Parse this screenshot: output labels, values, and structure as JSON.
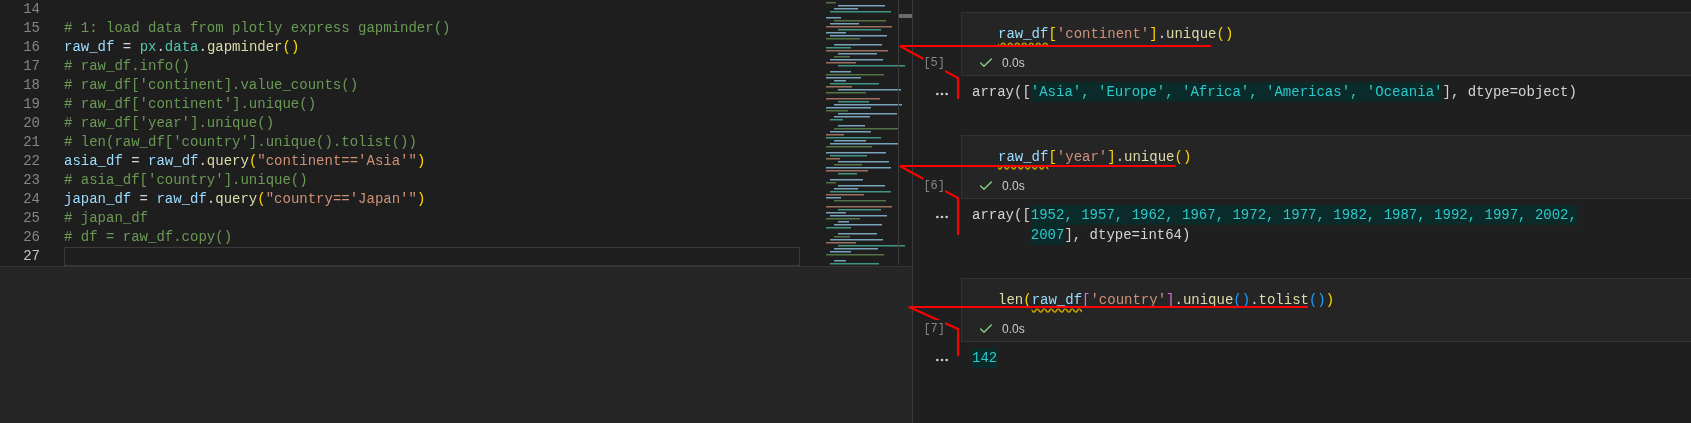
{
  "editor": {
    "lines": [
      {
        "number": "14",
        "current": false
      },
      {
        "number": "15",
        "current": false,
        "tokens": [
          {
            "text": "# 1: load data from plotly express gapminder()",
            "kind": "comment"
          }
        ]
      },
      {
        "number": "16",
        "current": false,
        "tokens": [
          {
            "text": "raw_df",
            "kind": "variable"
          },
          {
            "text": " = ",
            "kind": "plain"
          },
          {
            "text": "px",
            "kind": "module"
          },
          {
            "text": ".",
            "kind": "plain"
          },
          {
            "text": "data",
            "kind": "module"
          },
          {
            "text": ".",
            "kind": "plain"
          },
          {
            "text": "gapminder",
            "kind": "function"
          },
          {
            "text": "()",
            "kind": "bracket1"
          }
        ]
      },
      {
        "number": "17",
        "current": false,
        "tokens": [
          {
            "text": "# raw_df.info()",
            "kind": "comment"
          }
        ]
      },
      {
        "number": "18",
        "current": false,
        "tokens": [
          {
            "text": "# raw_df['continent].value_counts()",
            "kind": "comment"
          }
        ]
      },
      {
        "number": "19",
        "current": false,
        "tokens": [
          {
            "text": "# raw_df['continent'].unique()",
            "kind": "comment"
          }
        ]
      },
      {
        "number": "20",
        "current": false,
        "tokens": [
          {
            "text": "# raw_df['year'].unique()",
            "kind": "comment"
          }
        ]
      },
      {
        "number": "21",
        "current": false,
        "tokens": [
          {
            "text": "# len(raw_df['country'].unique().tolist())",
            "kind": "comment"
          }
        ]
      },
      {
        "number": "22",
        "current": false,
        "tokens": [
          {
            "text": "asia_df",
            "kind": "variable"
          },
          {
            "text": " = ",
            "kind": "plain"
          },
          {
            "text": "raw_df",
            "kind": "variable"
          },
          {
            "text": ".",
            "kind": "plain"
          },
          {
            "text": "query",
            "kind": "function"
          },
          {
            "text": "(",
            "kind": "bracket1"
          },
          {
            "text": "\"continent=='Asia'\"",
            "kind": "string"
          },
          {
            "text": ")",
            "kind": "bracket1"
          }
        ]
      },
      {
        "number": "23",
        "current": false,
        "tokens": [
          {
            "text": "# asia_df['country'].unique()",
            "kind": "comment"
          }
        ]
      },
      {
        "number": "24",
        "current": false,
        "tokens": [
          {
            "text": "japan_df",
            "kind": "variable"
          },
          {
            "text": " = ",
            "kind": "plain"
          },
          {
            "text": "raw_df",
            "kind": "variable"
          },
          {
            "text": ".",
            "kind": "plain"
          },
          {
            "text": "query",
            "kind": "function"
          },
          {
            "text": "(",
            "kind": "bracket1"
          },
          {
            "text": "\"country=='Japan'\"",
            "kind": "string"
          },
          {
            "text": ")",
            "kind": "bracket1"
          }
        ]
      },
      {
        "number": "25",
        "current": false,
        "tokens": [
          {
            "text": "# japan_df",
            "kind": "comment"
          }
        ]
      },
      {
        "number": "26",
        "current": false,
        "tokens": [
          {
            "text": "# df = raw_df.copy()",
            "kind": "comment"
          }
        ]
      },
      {
        "number": "27",
        "current": true
      }
    ]
  },
  "notebook": {
    "cells": [
      {
        "execution_count": "[5]",
        "duration": "0.0s",
        "code": [
          {
            "text": "raw_df",
            "kind": "variable",
            "warning": true
          },
          {
            "text": "[",
            "kind": "bracket1"
          },
          {
            "text": "'continent'",
            "kind": "string"
          },
          {
            "text": "]",
            "kind": "bracket1"
          },
          {
            "text": ".",
            "kind": "plain"
          },
          {
            "text": "unique",
            "kind": "function"
          },
          {
            "text": "()",
            "kind": "bracket1"
          }
        ],
        "output": [
          [
            {
              "text": "array([",
              "kind": "plain"
            },
            {
              "text": "'Asia', 'Europe', 'Africa', 'Americas', 'Oceania'",
              "kind": "value"
            },
            {
              "text": "], dtype=object)",
              "kind": "plain"
            }
          ]
        ]
      },
      {
        "execution_count": "[6]",
        "duration": "0.0s",
        "code": [
          {
            "text": "raw_df",
            "kind": "variable",
            "warning": true
          },
          {
            "text": "[",
            "kind": "bracket1"
          },
          {
            "text": "'year'",
            "kind": "string"
          },
          {
            "text": "]",
            "kind": "bracket1"
          },
          {
            "text": ".",
            "kind": "plain"
          },
          {
            "text": "unique",
            "kind": "function"
          },
          {
            "text": "()",
            "kind": "bracket1"
          }
        ],
        "output": [
          [
            {
              "text": "array([",
              "kind": "plain"
            },
            {
              "text": "1952, 1957, 1962, 1967, 1972, 1977, 1982, 1987, 1992, 1997, 2002,",
              "kind": "value"
            }
          ],
          [
            {
              "text": "2007",
              "kind": "value"
            },
            {
              "text": "], dtype=int64)",
              "kind": "plain"
            }
          ]
        ]
      },
      {
        "execution_count": "[7]",
        "duration": "0.0s",
        "code": [
          {
            "text": "len",
            "kind": "function"
          },
          {
            "text": "(",
            "kind": "bracket1"
          },
          {
            "text": "raw_df",
            "kind": "variable",
            "warning": true
          },
          {
            "text": "[",
            "kind": "bracket2"
          },
          {
            "text": "'country'",
            "kind": "string"
          },
          {
            "text": "]",
            "kind": "bracket2"
          },
          {
            "text": ".",
            "kind": "plain"
          },
          {
            "text": "unique",
            "kind": "function"
          },
          {
            "text": "()",
            "kind": "bracket3"
          },
          {
            "text": ".",
            "kind": "plain"
          },
          {
            "text": "tolist",
            "kind": "function"
          },
          {
            "text": "()",
            "kind": "bracket3"
          },
          {
            "text": ")",
            "kind": "bracket1"
          }
        ],
        "output": [
          [
            {
              "text": "142",
              "kind": "value"
            }
          ]
        ]
      }
    ]
  }
}
